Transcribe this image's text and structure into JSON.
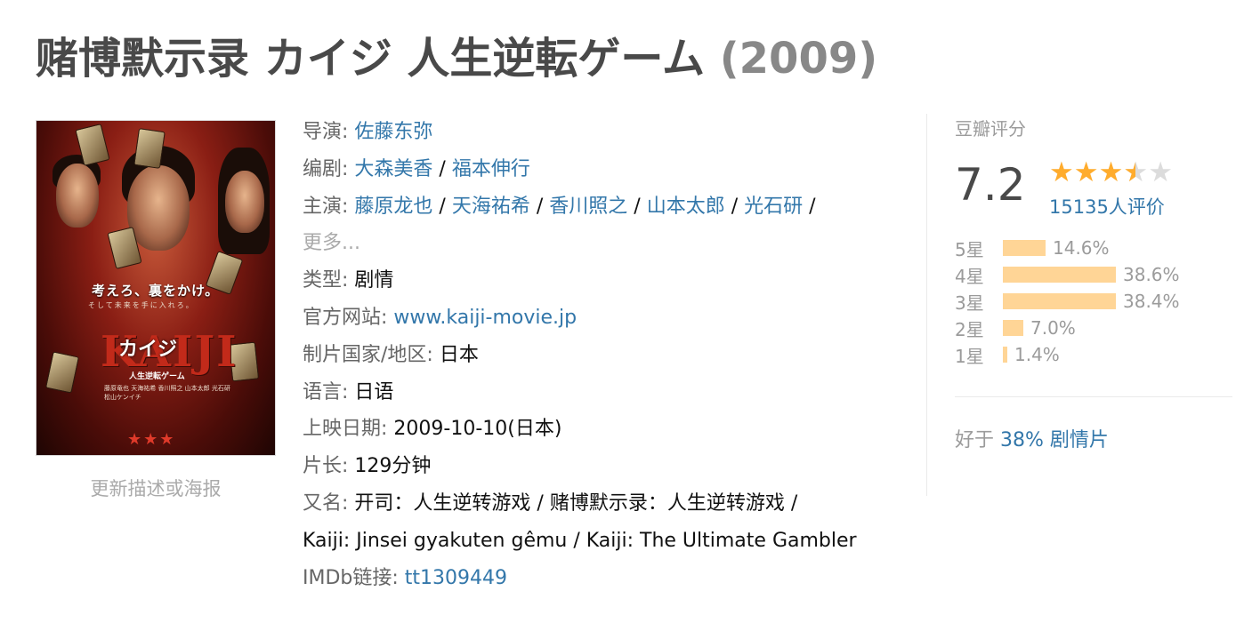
{
  "title": {
    "text": "赌博默示录 カイジ 人生逆転ゲーム",
    "year": "(2009)"
  },
  "poster": {
    "tagline": "考えろ、裏をかけ。",
    "tagline_sub": "そして未来を手に入れろ。",
    "logo_bg": "KAIJI",
    "logo_fg": "カイジ",
    "subtitle": "人生逆転ゲーム",
    "credits": "藤原竜也  天海祐希  香川照之  山本太郎  光石研  松山ケンイチ",
    "stars": "★★★",
    "update_link": "更新描述或海报"
  },
  "info": {
    "director": {
      "label": "导演",
      "names": [
        "佐藤东弥"
      ]
    },
    "writer": {
      "label": "编剧",
      "names": [
        "大森美香",
        "福本伸行"
      ]
    },
    "cast": {
      "label": "主演",
      "names": [
        "藤原龙也",
        "天海祐希",
        "香川照之",
        "山本太郎",
        "光石研"
      ],
      "more": "更多..."
    },
    "genre": {
      "label": "类型",
      "value": "剧情"
    },
    "website": {
      "label": "官方网站",
      "value": "www.kaiji-movie.jp"
    },
    "country": {
      "label": "制片国家/地区",
      "value": "日本"
    },
    "language": {
      "label": "语言",
      "value": "日语"
    },
    "release": {
      "label": "上映日期",
      "value": "2009-10-10(日本)"
    },
    "runtime": {
      "label": "片长",
      "value": "129分钟"
    },
    "aka": {
      "label": "又名",
      "line1": "开司：人生逆转游戏 / 赌博默示录：人生逆转游戏 /",
      "line2": "Kaiji: Jinsei gyakuten gêmu / Kaiji: The Ultimate Gambler"
    },
    "imdb": {
      "label": "IMDb链接",
      "value": "tt1309449"
    }
  },
  "rating": {
    "title": "豆瓣评分",
    "score": "7.2",
    "stars_value": 3.5,
    "stars_max": 5,
    "count": "15135人评价",
    "breakdown": [
      {
        "label": "5星",
        "percent": 14.6,
        "text": "14.6%"
      },
      {
        "label": "4星",
        "percent": 38.6,
        "text": "38.6%"
      },
      {
        "label": "3星",
        "percent": 38.4,
        "text": "38.4%"
      },
      {
        "label": "2星",
        "percent": 7.0,
        "text": "7.0%"
      },
      {
        "label": "1星",
        "percent": 1.4,
        "text": "1.4%"
      }
    ],
    "better_than": {
      "prefix": "好于 ",
      "link": "38% 剧情片"
    }
  },
  "colors": {
    "link": "#3377aa",
    "label_gray": "#666666",
    "muted_gray": "#9b9b9b",
    "star": "#ffac2d",
    "bar": "#ffd596"
  }
}
